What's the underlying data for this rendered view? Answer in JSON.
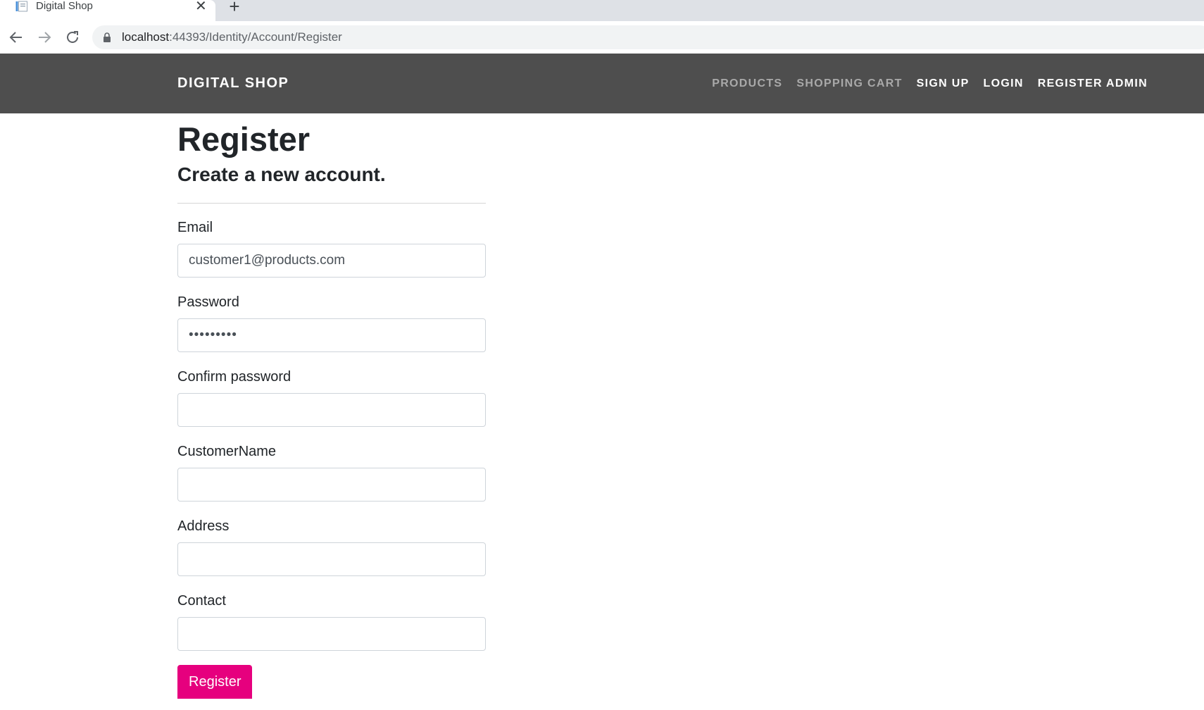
{
  "browser": {
    "tab_title": "Digital Shop",
    "tab_close": "✕",
    "new_tab": "+",
    "url_host": "localhost",
    "url_rest": ":44393/Identity/Account/Register"
  },
  "navbar": {
    "brand": "DIGITAL SHOP",
    "links": [
      {
        "label": "PRODUCTS",
        "style": "muted"
      },
      {
        "label": "SHOPPING CART",
        "style": "muted"
      },
      {
        "label": "SIGN UP",
        "style": "light"
      },
      {
        "label": "LOGIN",
        "style": "light"
      },
      {
        "label": "REGISTER ADMIN",
        "style": "light"
      }
    ],
    "background": "#4e4e4e"
  },
  "page": {
    "title": "Register",
    "subtitle": "Create a new account."
  },
  "form": {
    "email": {
      "label": "Email",
      "value": "customer1@products.com"
    },
    "password": {
      "label": "Password",
      "value": "•••••••••"
    },
    "confirm_password": {
      "label": "Confirm password",
      "value": ""
    },
    "customer_name": {
      "label": "CustomerName",
      "value": ""
    },
    "address": {
      "label": "Address",
      "value": ""
    },
    "contact": {
      "label": "Contact",
      "value": ""
    },
    "submit_label": "Register",
    "submit_color": "#e6007e"
  }
}
